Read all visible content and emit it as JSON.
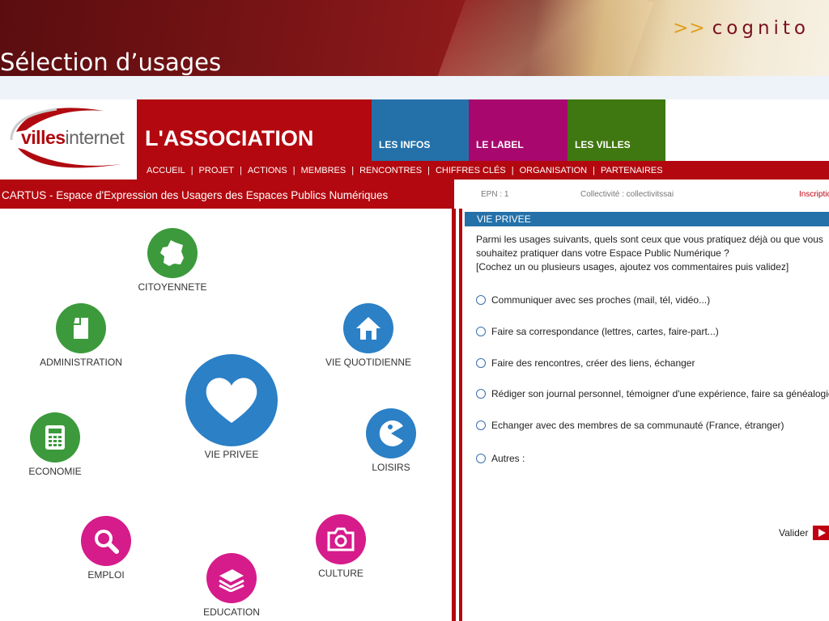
{
  "banner": {
    "brand_arrows": ">>",
    "brand_name": "cognito",
    "page_title": "Sélection d’usages"
  },
  "site": {
    "logo_bold": "villes",
    "logo_light": "internet",
    "association_title": "L'ASSOCIATION",
    "tabs": [
      "LES INFOS",
      "LE LABEL",
      "LES VILLES"
    ],
    "subnav": [
      "ACCUEIL",
      "PROJET",
      "ACTIONS",
      "MEMBRES",
      "RENCONTRES",
      "CHIFFRES CLÉS",
      "ORGANISATION",
      "PARTENAIRES"
    ],
    "subnav_sep": "|"
  },
  "left_panel": {
    "header": "CARTUS - Espace d'Expression des Usagers des Espaces Publics Numériques",
    "usages": [
      {
        "label": "CITOYENNETE",
        "icon": "france-map-icon",
        "color": "#3c9a3c"
      },
      {
        "label": "ADMINISTRATION",
        "icon": "document-icon",
        "color": "#3c9a3c"
      },
      {
        "label": "VIE QUOTIDIENNE",
        "icon": "house-icon",
        "color": "#2b80c6"
      },
      {
        "label": "VIE PRIVEE",
        "icon": "heart-icon",
        "color": "#2b80c6"
      },
      {
        "label": "ECONOMIE",
        "icon": "calculator-icon",
        "color": "#3c9a3c"
      },
      {
        "label": "LOISIRS",
        "icon": "pacman-icon",
        "color": "#2b80c6"
      },
      {
        "label": "EMPLOI",
        "icon": "magnifier-icon",
        "color": "#d61b8b"
      },
      {
        "label": "CULTURE",
        "icon": "camera-icon",
        "color": "#d61b8b"
      },
      {
        "label": "EDUCATION",
        "icon": "books-icon",
        "color": "#d61b8b"
      }
    ]
  },
  "right_panel": {
    "epn": "EPN : 1",
    "collectivite": "Collectivité : collectivitssai",
    "inscription": "Inscriptio",
    "section_title": "VIE PRIVEE",
    "intro_line1": "Parmi les usages suivants, quels sont ceux que vous pratiquez déjà ou que vous souhaitez pratiquer dans votre Espace Public Numérique ?",
    "intro_line2": "[Cochez un ou plusieurs usages, ajoutez vos commentaires puis validez]",
    "options": [
      "Communiquer avec ses proches (mail, tél, vidéo...)",
      "Faire sa correspondance (lettres, cartes, faire-part...)",
      "Faire des rencontres, créer des liens, échanger",
      "Rédiger son journal personnel, témoigner d'une expérience, faire sa généalogie",
      "Echanger avec des membres de sa communauté (France, étranger)",
      "Autres :"
    ],
    "submit_label": "Valider"
  }
}
